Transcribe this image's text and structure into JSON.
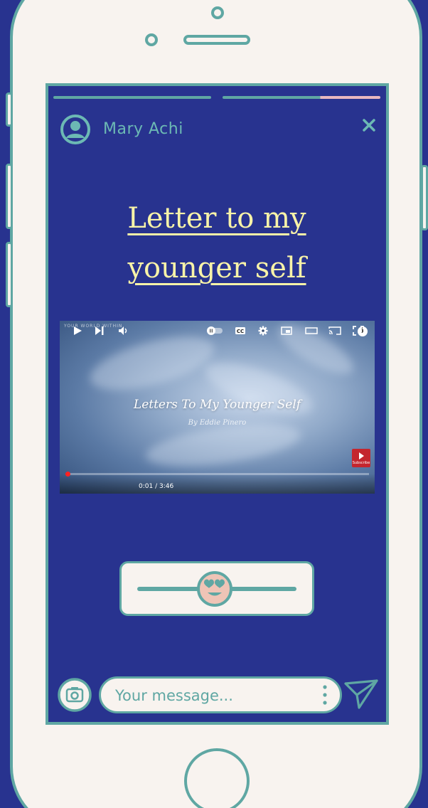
{
  "story": {
    "username": "Mary Achi",
    "title": "Letter to my younger self"
  },
  "video": {
    "channel": "YOUR WORLD WITHIN",
    "title": "Letters To My Younger Self",
    "subtitle": "By Eddie Pinero",
    "time": "0:01 / 3:46",
    "subscribe_label": "Subscribe",
    "info_label": "i"
  },
  "message": {
    "placeholder": "Your message..."
  },
  "reaction_slider": {
    "value": 0.42,
    "emoji": "heart-eyes"
  },
  "colors": {
    "background": "#28338f",
    "frame": "#f8f3ef",
    "accent": "#5fa7a3",
    "title": "#f8f3a8"
  }
}
